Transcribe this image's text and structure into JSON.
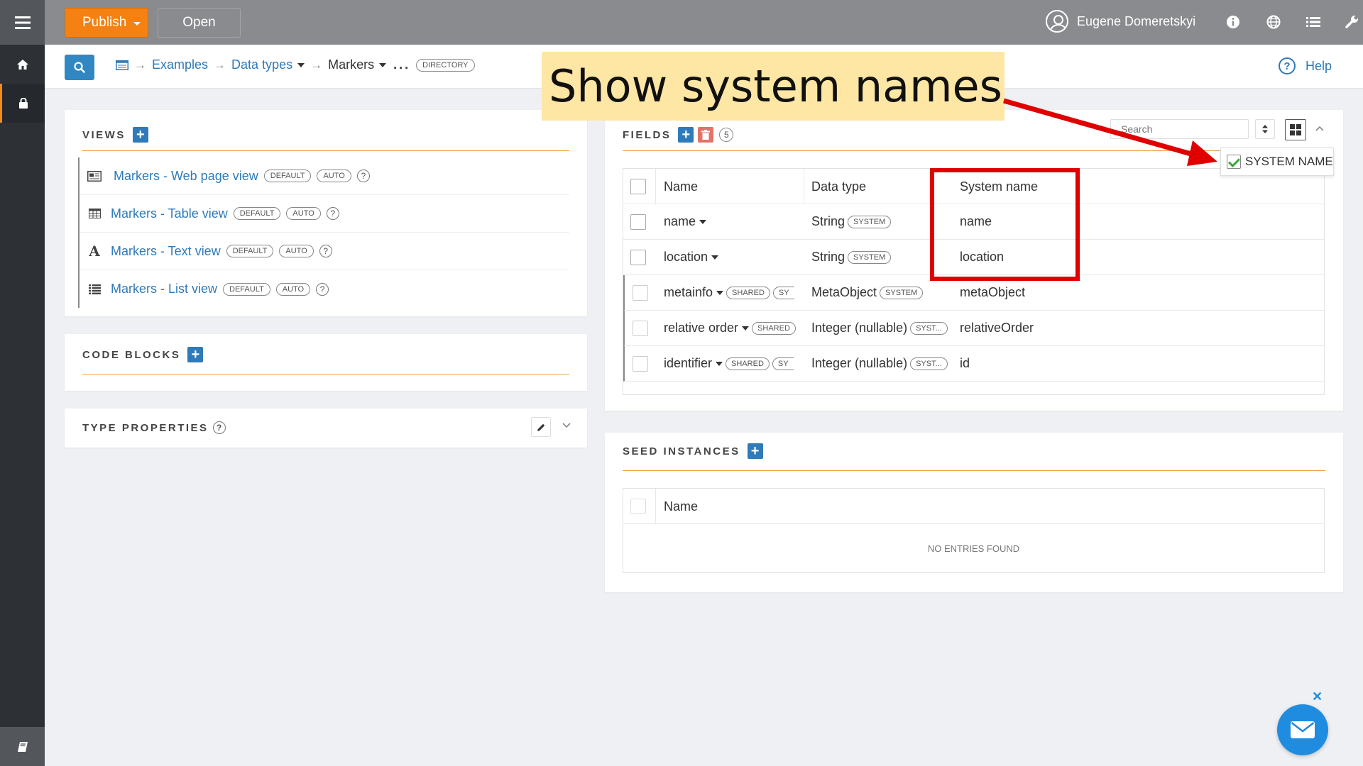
{
  "topbar": {
    "publish_label": "Publish",
    "open_label": "Open",
    "user_name": "Eugene Domeretskyi"
  },
  "breadcrumb": {
    "items": [
      "Examples",
      "Data types",
      "Markers"
    ],
    "ellipsis": "...",
    "badge": "DIRECTORY"
  },
  "help_label": "Help",
  "annotation": {
    "callout_text": "Show system names"
  },
  "views": {
    "title": "VIEWS",
    "items": [
      {
        "label": "Markers - Web page view",
        "badges": [
          "DEFAULT",
          "AUTO"
        ],
        "icon": "web-page-icon"
      },
      {
        "label": "Markers - Table view",
        "badges": [
          "DEFAULT",
          "AUTO"
        ],
        "icon": "table-icon"
      },
      {
        "label": "Markers - Text view",
        "badges": [
          "DEFAULT",
          "AUTO"
        ],
        "icon": "text-icon"
      },
      {
        "label": "Markers - List view",
        "badges": [
          "DEFAULT",
          "AUTO"
        ],
        "icon": "list-icon"
      }
    ]
  },
  "code_blocks": {
    "title": "CODE BLOCKS"
  },
  "type_properties": {
    "title": "TYPE PROPERTIES"
  },
  "fields": {
    "title": "FIELDS",
    "count": "5",
    "search_placeholder": "Search",
    "column_toggle_label": "SYSTEM NAME",
    "headers": {
      "name": "Name",
      "data_type": "Data type",
      "system_name": "System name"
    },
    "rows": [
      {
        "name": "name",
        "badges": [],
        "type": "String",
        "type_badge": "SYSTEM",
        "system_name": "name"
      },
      {
        "name": "location",
        "badges": [],
        "type": "String",
        "type_badge": "SYSTEM",
        "system_name": "location"
      },
      {
        "name": "metainfo",
        "badges": [
          "SHARED",
          "SY"
        ],
        "type": "MetaObject",
        "type_badge": "SYSTEM",
        "system_name": "metaObject"
      },
      {
        "name": "relative order",
        "badges": [
          "SHARED"
        ],
        "type": "Integer (nullable)",
        "type_badge": "SYST...",
        "system_name": "relativeOrder"
      },
      {
        "name": "identifier",
        "badges": [
          "SHARED",
          "SY"
        ],
        "type": "Integer (nullable)",
        "type_badge": "SYST...",
        "system_name": "id"
      }
    ]
  },
  "seed_instances": {
    "title": "SEED INSTANCES",
    "header_name": "Name",
    "empty_text": "NO ENTRIES FOUND"
  },
  "colors": {
    "accent_orange": "#f48112",
    "link_blue": "#2f7ab8",
    "annotation_red": "#e00000",
    "callout_yellow": "#fee6a5"
  }
}
